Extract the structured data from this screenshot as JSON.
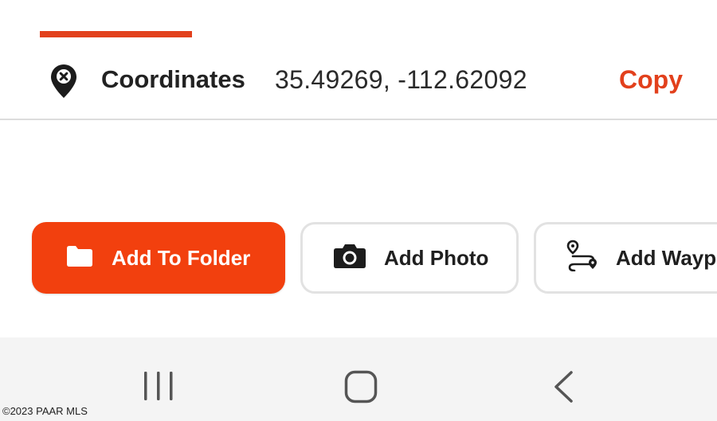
{
  "coordinates": {
    "label": "Coordinates",
    "value": "35.49269, -112.62092",
    "copy_label": "Copy",
    "icon": "map-pin-x-icon"
  },
  "actions": [
    {
      "label": "Add To Folder",
      "icon": "folder-icon",
      "style": "primary"
    },
    {
      "label": "Add Photo",
      "icon": "camera-icon",
      "style": "outline"
    },
    {
      "label": "Add Waypo",
      "icon": "route-icon",
      "style": "outline"
    }
  ],
  "nav": {
    "recent_icon": "recent-apps-icon",
    "home_icon": "home-icon",
    "back_icon": "back-icon"
  },
  "watermark": "©2023 PAAR MLS",
  "colors": {
    "accent": "#e2401c",
    "primary_button": "#f2400e",
    "nav_background": "#f4f4f4"
  }
}
